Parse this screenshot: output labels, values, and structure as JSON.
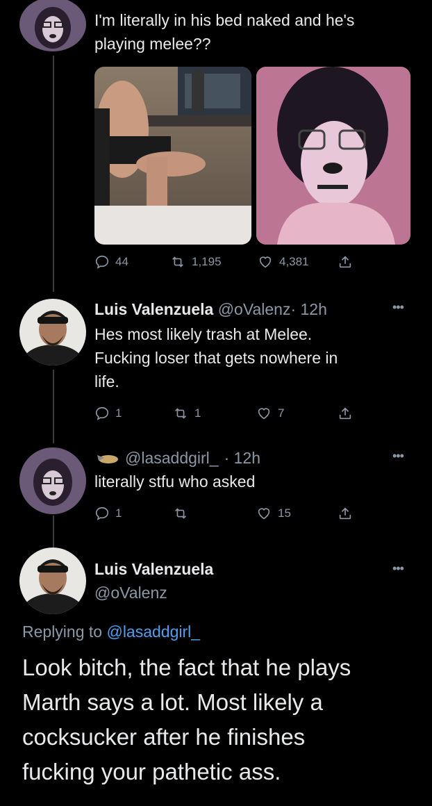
{
  "theme": {
    "background": "#000000",
    "text": "#e7e9ea",
    "muted": "#8b98a5",
    "link": "#4d9ff0",
    "thread_line": "#3a3d40"
  },
  "tweet1": {
    "text_line1": "I'm literally in his bed naked and he's",
    "text_line2": "playing melee??",
    "replies": "44",
    "retweets": "1,195",
    "likes": "4,381"
  },
  "tweet2": {
    "name": "Luis Valenzuela",
    "handle": "@oValenz",
    "time": "· 12h",
    "text_line1": "Hes most likely trash at Melee.",
    "text_line2": "Fucking loser that gets nowhere in",
    "text_line3": "life.",
    "replies": "1",
    "retweets": "1",
    "likes": "7"
  },
  "tweet3": {
    "handle": "@lasaddgirl_",
    "time": "· 12h",
    "text": "literally stfu who asked",
    "replies": "1",
    "retweets": "",
    "likes": "15"
  },
  "main_tweet": {
    "name": "Luis Valenzuela",
    "handle": "@oValenz",
    "replying_prefix": "Replying to ",
    "replying_handle": "@lasaddgirl_",
    "text_line1": "Look bitch, the fact that he plays",
    "text_line2": "Marth says a lot. Most likely a",
    "text_line3": "cocksucker after he finishes",
    "text_line4": "fucking your pathetic ass."
  },
  "icons": [
    "reply-icon",
    "retweet-icon",
    "like-icon",
    "share-icon",
    "more-icon"
  ]
}
